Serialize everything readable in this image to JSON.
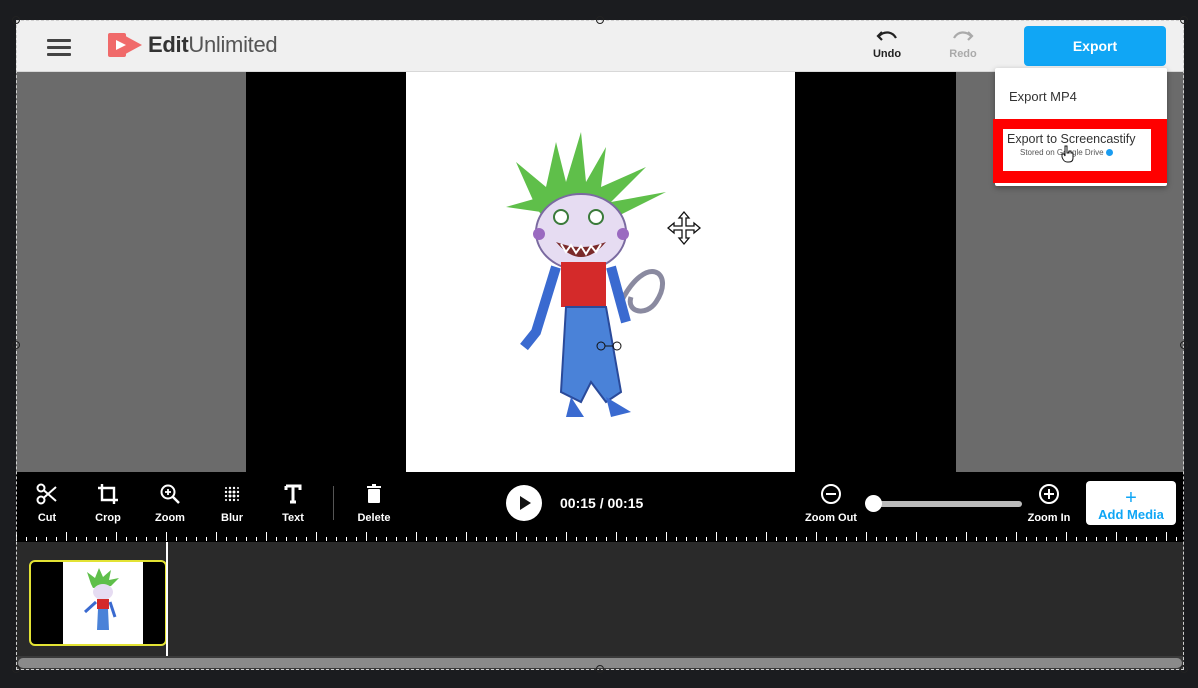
{
  "app": {
    "name_part1": "Edit",
    "name_part2": "Unlimited"
  },
  "header": {
    "undo_label": "Undo",
    "redo_label": "Redo",
    "export_label": "Export"
  },
  "export_menu": {
    "items": [
      {
        "label": "Export MP4"
      },
      {
        "label": "Export to Screencastify",
        "sublabel": "Stored on Google Drive"
      }
    ],
    "highlight_color": "#ff0000"
  },
  "toolbar": {
    "tools": [
      {
        "label": "Cut",
        "icon": "scissors-icon"
      },
      {
        "label": "Crop",
        "icon": "crop-icon"
      },
      {
        "label": "Zoom",
        "icon": "zoom-icon"
      },
      {
        "label": "Blur",
        "icon": "blur-icon"
      },
      {
        "label": "Text",
        "icon": "text-icon"
      },
      {
        "label": "Delete",
        "icon": "trash-icon"
      }
    ],
    "timecode": "00:15 / 00:15",
    "zoom_out_label": "Zoom Out",
    "zoom_in_label": "Zoom In",
    "zoom_level": 0,
    "add_media_plus": "+",
    "add_media_label": "Add Media"
  },
  "colors": {
    "accent": "#10a6f5",
    "clip_border": "#e3e334",
    "logo": "#f06a6a"
  }
}
